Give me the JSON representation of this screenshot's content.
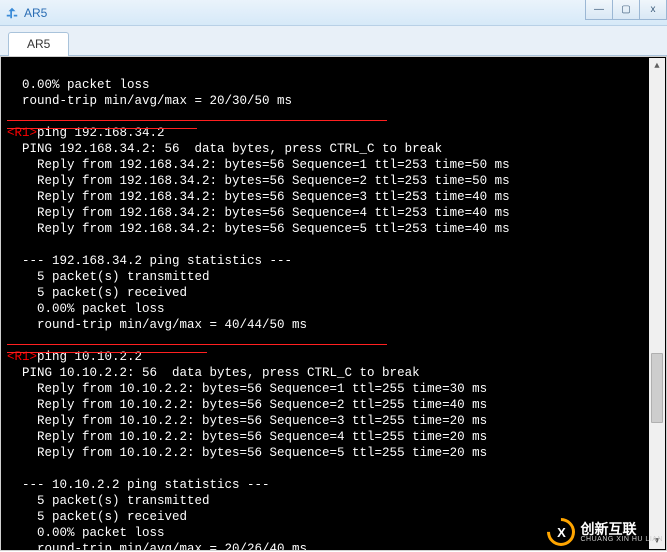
{
  "window": {
    "title": "AR5",
    "controls": {
      "min": "—",
      "max": "▢",
      "close": "x"
    }
  },
  "tabs": [
    {
      "label": "AR5"
    }
  ],
  "terminal": {
    "block0": {
      "loss": "  0.00% packet loss",
      "rtt": "  round-trip min/avg/max = 20/30/50 ms"
    },
    "cmd1": {
      "prompt": "<R1>",
      "command": "ping 192.168.34.2"
    },
    "block1": {
      "header": "  PING 192.168.34.2: 56  data bytes, press CTRL_C to break",
      "replies": [
        "    Reply from 192.168.34.2: bytes=56 Sequence=1 ttl=253 time=50 ms",
        "    Reply from 192.168.34.2: bytes=56 Sequence=2 ttl=253 time=50 ms",
        "    Reply from 192.168.34.2: bytes=56 Sequence=3 ttl=253 time=40 ms",
        "    Reply from 192.168.34.2: bytes=56 Sequence=4 ttl=253 time=40 ms",
        "    Reply from 192.168.34.2: bytes=56 Sequence=5 ttl=253 time=40 ms"
      ],
      "stats_hdr": "  --- 192.168.34.2 ping statistics ---",
      "tx": "    5 packet(s) transmitted",
      "rx": "    5 packet(s) received",
      "loss": "    0.00% packet loss",
      "rtt": "    round-trip min/avg/max = 40/44/50 ms"
    },
    "cmd2": {
      "prompt": "<R1>",
      "command": "ping 10.10.2.2"
    },
    "block2": {
      "header": "  PING 10.10.2.2: 56  data bytes, press CTRL_C to break",
      "replies": [
        "    Reply from 10.10.2.2: bytes=56 Sequence=1 ttl=255 time=30 ms",
        "    Reply from 10.10.2.2: bytes=56 Sequence=2 ttl=255 time=40 ms",
        "    Reply from 10.10.2.2: bytes=56 Sequence=3 ttl=255 time=20 ms",
        "    Reply from 10.10.2.2: bytes=56 Sequence=4 ttl=255 time=20 ms",
        "    Reply from 10.10.2.2: bytes=56 Sequence=5 ttl=255 time=20 ms"
      ],
      "stats_hdr": "  --- 10.10.2.2 ping statistics ---",
      "tx": "    5 packet(s) transmitted",
      "rx": "    5 packet(s) received",
      "loss": "    0.00% packet loss",
      "rtt": "    round-trip min/avg/max = 20/26/40 ms"
    }
  },
  "watermark": {
    "logo_letter": "X",
    "cn": "创新互联",
    "en": "CHUANG XIN HU LIAN"
  }
}
